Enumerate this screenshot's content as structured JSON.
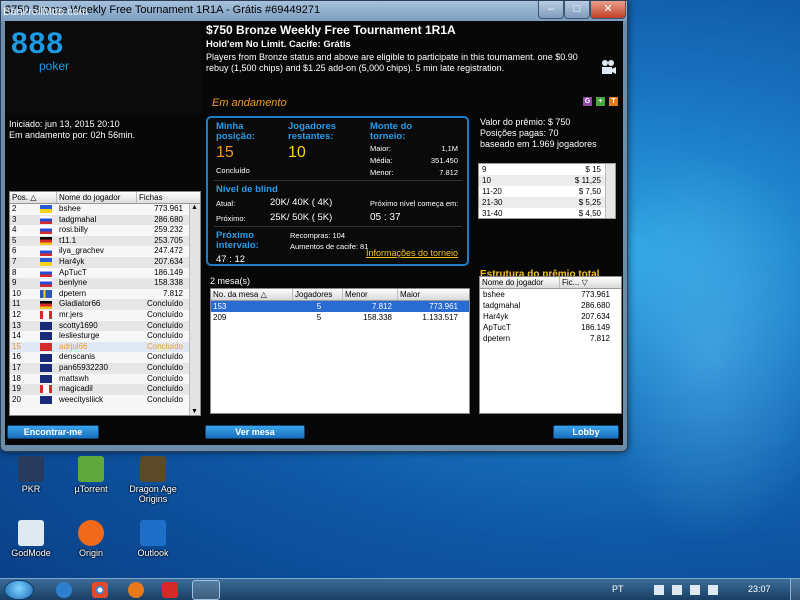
{
  "window": {
    "title": "$750 Bronze Weekly Free Tournament 1R1A - Grátis #69449271",
    "watermark": "BankrollMob.com"
  },
  "logo": {
    "brand": "888",
    "sub": "poker"
  },
  "started": {
    "line1": "Iniciado: jun 13, 2015 20:10",
    "line2": "Em andamento por: 02h 56min."
  },
  "header": {
    "title": "$750 Bronze Weekly Free Tournament 1R1A",
    "subtitle": "Hold'em No Limit. Cacife: Grátis",
    "description": "Players from Bronze status and above are eligible to participate in this tournament. one $0.90 rebuy (1,500 chips) and $1.25 add-on (5,000 chips). 5 min late registration.",
    "status": "Em andamento",
    "mini_icons": [
      "G",
      "+",
      "T"
    ]
  },
  "stats": {
    "my_position_label": "Minha posição:",
    "my_position": "15",
    "my_status": "Concluído",
    "remaining_label": "Jogadores restantes:",
    "remaining": "10",
    "pot_label": "Monte do torneio:",
    "largest_label": "Maior:",
    "largest": "1,1M",
    "average_label": "Média:",
    "average": "351.450",
    "smallest_label": "Menor:",
    "smallest": "7.812",
    "blind_label": "Nível de blind",
    "current_label": "Atual:",
    "current": "20K/ 40K ( 4K)",
    "next_label": "Próximo:",
    "next": "25K/ 50K ( 5K)",
    "next_level_label": "Próximo nível começa em:",
    "next_level_time": "05 : 37",
    "break_label": "Próximo intervalo:",
    "break_time": "47 : 12",
    "rebuys": "Recompras: 104",
    "addons": "Aumentos de cacife: 81",
    "info_link": "Informações do torneio"
  },
  "prize": {
    "value": "Valor do prêmio: $ 750",
    "paid": "Posições pagas: 70",
    "basis": "baseado em 1.969 jogadores",
    "rows": [
      {
        "pos": "9",
        "amount": "$ 15"
      },
      {
        "pos": "10",
        "amount": "$ 11,25"
      },
      {
        "pos": "11-20",
        "amount": "$ 7,50"
      },
      {
        "pos": "21-30",
        "amount": "$ 5,25"
      },
      {
        "pos": "31-40",
        "amount": "$ 4,50"
      }
    ],
    "structure_link": "Estrutura do prêmio total"
  },
  "players": {
    "headers": [
      "Pos.",
      "Nome do jogador",
      "Fichas"
    ],
    "rows": [
      {
        "pos": "2",
        "name": "bshee",
        "chips": "773.961",
        "flag": "ua"
      },
      {
        "pos": "3",
        "name": "tadgmahal",
        "chips": "286.680",
        "flag": "ru"
      },
      {
        "pos": "4",
        "name": "rosi.billy",
        "chips": "259.232",
        "flag": "ru"
      },
      {
        "pos": "5",
        "name": "t11.1",
        "chips": "253.705",
        "flag": "de"
      },
      {
        "pos": "6",
        "name": "ilya_grachev",
        "chips": "247.472",
        "flag": "ru"
      },
      {
        "pos": "7",
        "name": "Har4yk",
        "chips": "207.634",
        "flag": "ua"
      },
      {
        "pos": "8",
        "name": "ApTucT",
        "chips": "186.149",
        "flag": "ru"
      },
      {
        "pos": "9",
        "name": "benlyne",
        "chips": "158.338",
        "flag": "ru"
      },
      {
        "pos": "10",
        "name": "dpetern",
        "chips": "7.812",
        "flag": "se"
      },
      {
        "pos": "11",
        "name": "Gladiator66",
        "chips": "Concluído",
        "flag": "de"
      },
      {
        "pos": "12",
        "name": "mr.jers",
        "chips": "Concluído",
        "flag": "ca"
      },
      {
        "pos": "13",
        "name": "scotty1690",
        "chips": "Concluído",
        "flag": "gb"
      },
      {
        "pos": "14",
        "name": "lesliesturge",
        "chips": "Concluído",
        "flag": "gb"
      },
      {
        "pos": "15",
        "name": "adrjul66",
        "chips": "Concluído",
        "flag": "tr"
      },
      {
        "pos": "16",
        "name": "denscanis",
        "chips": "Concluído",
        "flag": "gb"
      },
      {
        "pos": "17",
        "name": "pan65932230",
        "chips": "Concluído",
        "flag": "au"
      },
      {
        "pos": "18",
        "name": "mattswh",
        "chips": "Concluído",
        "flag": "gb"
      },
      {
        "pos": "19",
        "name": "magicadil",
        "chips": "Concluído",
        "flag": "ca"
      },
      {
        "pos": "20",
        "name": "weecitysliick",
        "chips": "Concluído",
        "flag": "gb"
      }
    ]
  },
  "tables": {
    "count_label": "2 mesa(s)",
    "headers": [
      "No. da mesa",
      "Jogadores",
      "Menor",
      "Maior"
    ],
    "rows": [
      {
        "num": "153",
        "players": "5",
        "min": "7.812",
        "max": "773.961"
      },
      {
        "num": "209",
        "players": "5",
        "min": "158.338",
        "max": "1.133.517"
      }
    ]
  },
  "table_players": {
    "headers": [
      "Nome do jogador",
      "Fic..."
    ],
    "rows": [
      {
        "name": "bshee",
        "chips": "773.961"
      },
      {
        "name": "tadgmahal",
        "chips": "286.680"
      },
      {
        "name": "Har4yk",
        "chips": "207.634"
      },
      {
        "name": "ApTucT",
        "chips": "186.149"
      },
      {
        "name": "dpetern",
        "chips": "7.812"
      }
    ]
  },
  "buttons": {
    "find_me": "Encontrar-me",
    "view_table": "Ver mesa",
    "lobby": "Lobby"
  },
  "desktop_icons": [
    {
      "label": "PKR",
      "color": "#2a3a5a"
    },
    {
      "label": "µTorrent",
      "color": "#5ea83c"
    },
    {
      "label": "Dragon Age Origins",
      "color": "#5a4a2a"
    },
    {
      "label": "GodMode",
      "color": "#e0e8f0"
    },
    {
      "label": "Origin",
      "color": "#f06a1c"
    },
    {
      "label": "Outlook",
      "color": "#1e6fc8"
    }
  ],
  "taskbar": {
    "language": "PT",
    "clock": "23:07"
  },
  "colors": {
    "accent_blue": "#2a9ce8",
    "status_orange": "#f39a1c",
    "remaining_yellow": "#ffd400",
    "link_yellow": "#f3c41c"
  }
}
